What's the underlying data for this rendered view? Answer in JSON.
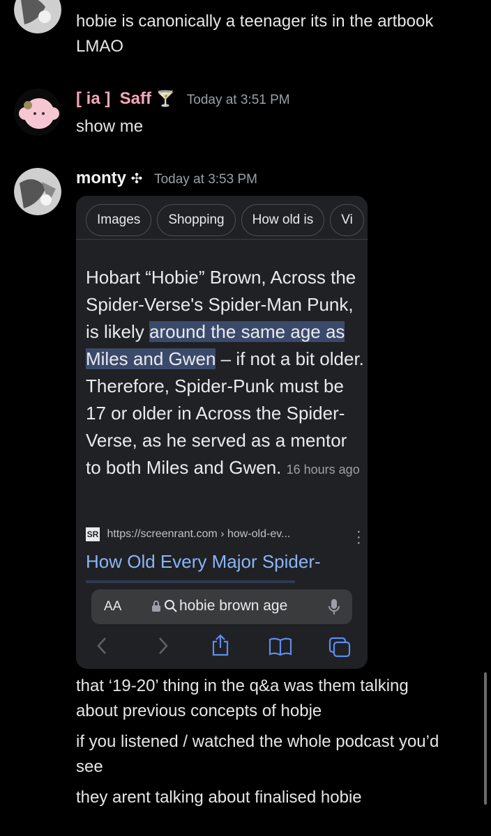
{
  "messages": {
    "first": {
      "text1": "hobie is canonically a teenager its in the artbook",
      "text2": "LMAO"
    },
    "second": {
      "author": "[ ia ]  Saff",
      "author_emoji": "🍸",
      "time": "Today at 3:51 PM",
      "text": "show me"
    },
    "third": {
      "author": "monty",
      "author_symbol": "✣",
      "time": "Today at 3:53 PM",
      "after_image": [
        "that ‘19-20’ thing in the q&a was them talking",
        "about previous concepts of hobje",
        "if you listened / watched the whole podcast you’d",
        "see",
        "they arent talking about finalised hobie"
      ]
    }
  },
  "screenshot": {
    "chips": [
      "Images",
      "Shopping",
      "How old is",
      "Vi"
    ],
    "answer": {
      "part1": "Hobart “Hobie” Brown, Across the Spider-Verse's Spider-Man Punk, is likely ",
      "highlight": "around the same age as Miles and Gwen",
      "part2": " – if not a bit older. Therefore, Spider-Punk must be 17 or older in Across the Spider-Verse, as he served as a mentor to both Miles and Gwen.",
      "ago": "16 hours ago"
    },
    "source_logo": "SR",
    "source_url": "https://screenrant.com › how-old-ev...",
    "result_title": "How Old Every Major Spider-",
    "urlbar": {
      "aa": "AA",
      "query": "hobie brown age"
    }
  },
  "colors": {
    "saff_name": "#f4a7b9",
    "highlight": "#3b4a6b",
    "link": "#8ab4f8"
  }
}
